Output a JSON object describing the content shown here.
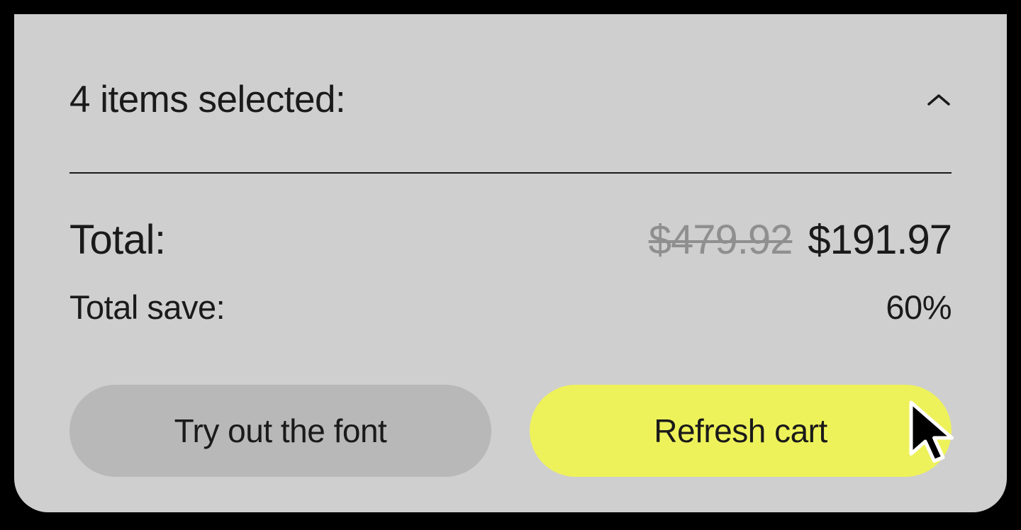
{
  "summary": {
    "items_selected_label": "4 items selected:",
    "total_label": "Total:",
    "price_original": "$479.92",
    "price_current": "$191.97",
    "save_label": "Total save:",
    "save_value": "60%"
  },
  "buttons": {
    "try_font_label": "Try out the font",
    "refresh_cart_label": "Refresh cart"
  }
}
